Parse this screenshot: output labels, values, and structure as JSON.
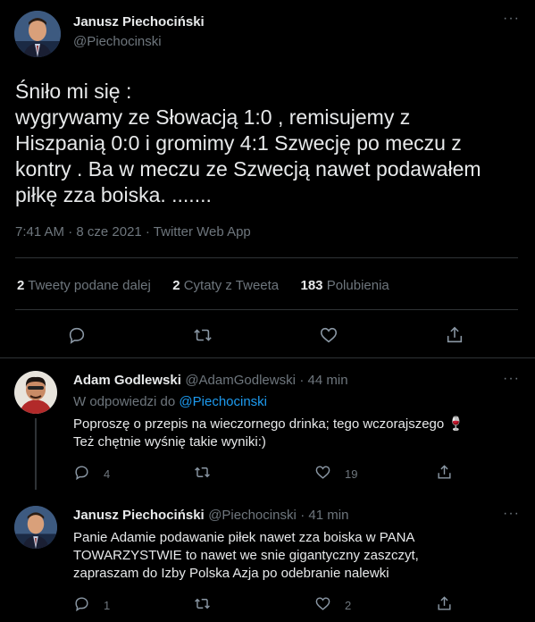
{
  "main_tweet": {
    "author_name": "Janusz Piechociński",
    "author_handle": "@Piechocinski",
    "text_lines": [
      "Śniło mi się :",
      "wygrywamy ze Słowacją 1:0 , remisujemy z",
      "Hiszpanią 0:0 i gromimy  4:1 Szwecję po meczu z",
      "kontry . Ba w meczu ze Szwecją nawet podawałem",
      "piłkę zza boiska. ......."
    ],
    "meta": "7:41 AM · 8 cze 2021 · Twitter Web App",
    "stats": {
      "retweets_count": "2",
      "retweets_label": "Tweety podane dalej",
      "quotes_count": "2",
      "quotes_label": "Cytaty z Tweeta",
      "likes_count": "183",
      "likes_label": "Polubienia"
    }
  },
  "replies": [
    {
      "author_name": "Adam Godlewski",
      "author_handle": "@AdamGodlewski",
      "time": "· 44 min",
      "reply_prefix": "W odpowiedzi do",
      "reply_to": "@Piechocinski",
      "text_lines": [
        "Poproszę o przepis na wieczornego drinka; tego wczorajszego 🍷",
        "Też chętnie wyśnię takie wyniki:)"
      ],
      "reply_count": "4",
      "retweet_count": "",
      "like_count": "19"
    },
    {
      "author_name": "Janusz Piechociński",
      "author_handle": "@Piechocinski",
      "time": "· 41 min",
      "text_lines": [
        "Panie Adamie podawanie piłek nawet zza boiska w PANA",
        "TOWARZYSTWIE to nawet we snie gigantyczny zaszczyt,",
        "zapraszam do Izby Polska Azja po odebranie nalewki"
      ],
      "reply_count": "1",
      "retweet_count": "",
      "like_count": "2"
    }
  ],
  "more_glyph": "···"
}
